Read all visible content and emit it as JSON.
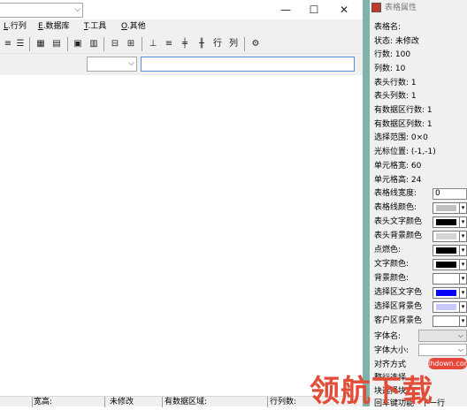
{
  "window": {
    "minimize": "—",
    "maximize": "☐",
    "close": "✕"
  },
  "menu": {
    "items": [
      {
        "key": "L",
        "label": ".行列"
      },
      {
        "key": "E",
        "label": ".数据库"
      },
      {
        "key": "T",
        "label": ".工具"
      },
      {
        "key": "O",
        "label": ".其他"
      }
    ]
  },
  "toolbar": {
    "icons": [
      "grid-icon",
      "table-icon",
      "form-icon",
      "report-icon",
      "export-icon",
      "print-icon",
      "insert-row-icon",
      "insert-col-icon",
      "col-split-icon",
      "row-text-icon",
      "col-text-icon",
      "settings-icon"
    ],
    "text_buttons": [
      "行",
      "列"
    ]
  },
  "inputs": {
    "combo1_value": "",
    "combo2_value": "",
    "text_value": ""
  },
  "status": {
    "item1": "宽高:",
    "item2": "未修改",
    "item3": "有数据区域:",
    "item4": "行列数:"
  },
  "panel": {
    "title": "表格属性",
    "table_name": "表格名:",
    "state": "状态: 未修改",
    "rows": "行数: 100",
    "cols": "列数: 10",
    "header_rows": "表头行数: 1",
    "header_cols": "表头列数: 1",
    "data_rows": "有数据区行数: 1",
    "data_cols": "有数据区列数: 1",
    "selection": "选择范围: 0×0",
    "cursor": "光标位置: (-1,-1)",
    "cell_width": "单元格宽: 60",
    "cell_height": "单元格高: 24",
    "line_width_label": "表格线宽度:",
    "line_width_value": "0",
    "line_color": "表格线颜色:",
    "header_text_color": "表头文字颜色",
    "header_bg_color": "表头背景颜色",
    "point_color": "点燃色:",
    "text_color": "文字颜色:",
    "bg_color": "背景颜色:",
    "sel_text_color": "选择区文字色",
    "sel_bg_color": "选择区背景色",
    "client_bg_color": "客户区背景色",
    "font_name": "字体名:",
    "font_size": "字体大小:",
    "align": "对齐方式",
    "select": "整行选择",
    "select_block": "块选择块",
    "enter_func": "回车键功能",
    "enter_func_value": "下一行"
  },
  "colors": {
    "line_color": "#c0c0c0",
    "header_text_color": "#000000",
    "header_bg_color": "#d4d4d4",
    "point_color": "#000000",
    "text_color": "#000000",
    "bg_color": "#ffffff",
    "sel_text_color": "#0000ff",
    "sel_bg_color": "#c8c8ff",
    "client_bg_color": "#ffffff",
    "divider": "#7fb2ab"
  },
  "watermark": {
    "badge": "lhdown.com",
    "text": "领航下载"
  }
}
